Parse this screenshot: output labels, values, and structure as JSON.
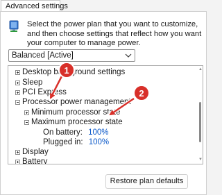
{
  "dialog": {
    "tab_label": "Advanced settings",
    "description": "Select the power plan that you want to customize, and then choose settings that reflect how you want your computer to manage power.",
    "plan_select": {
      "value": "Balanced [Active]"
    },
    "restore_button_label": "Restore plan defaults"
  },
  "tree": {
    "items": [
      {
        "label": "Desktop background settings",
        "expander": "plus"
      },
      {
        "label": "Sleep",
        "expander": "plus"
      },
      {
        "label": "PCI Express",
        "expander": "plus"
      },
      {
        "label": "Processor power management",
        "expander": "minus"
      },
      {
        "label": "Minimum processor state",
        "expander": "plus"
      },
      {
        "label": "Maximum processor state",
        "expander": "minus"
      },
      {
        "label": "On battery:",
        "value": "100%"
      },
      {
        "label": "Plugged in:",
        "value": "100%"
      },
      {
        "label": "Display",
        "expander": "plus"
      },
      {
        "label": "Battery",
        "expander": "plus"
      }
    ]
  },
  "annotations": [
    {
      "number": "1"
    },
    {
      "number": "2"
    }
  ],
  "colors": {
    "link_value": "#0a58c9",
    "annotation": "#d8302a",
    "annotation_outline": "#ffffff"
  }
}
